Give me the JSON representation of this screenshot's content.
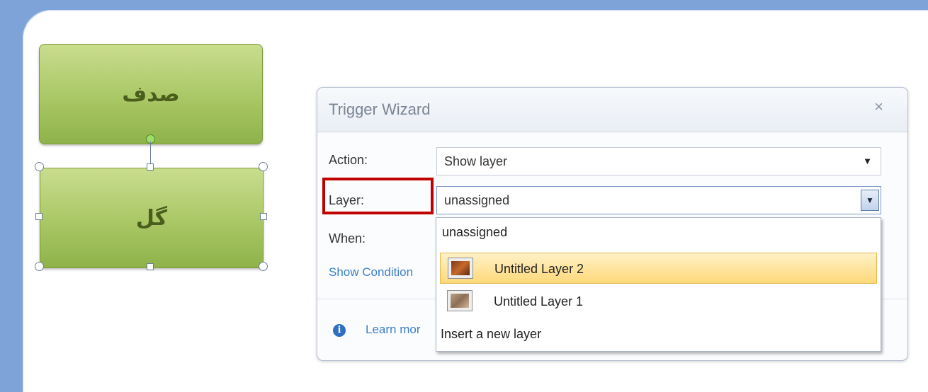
{
  "slide": {
    "shape_top_text": "صدف",
    "shape_bottom_text": "گل"
  },
  "dialog": {
    "title": "Trigger Wizard",
    "close_glyph": "×",
    "action_label": "Action:",
    "action_value": "Show layer",
    "layer_label": "Layer:",
    "layer_value": "unassigned",
    "when_label": "When:",
    "show_conditions_link": "Show Condition",
    "learn_more_link": "Learn mor",
    "dropdown_arrow_glyph": "▼",
    "info_glyph": "i"
  },
  "layer_dropdown": {
    "items": [
      {
        "label": "unassigned"
      },
      {
        "label": "Untitled Layer 2",
        "selected": true
      },
      {
        "label": "Untitled Layer 1"
      },
      {
        "label": "Insert a new layer"
      }
    ]
  },
  "colors": {
    "highlight_outline": "#c00000",
    "shape_fill": "#a9c765",
    "selected_item": "#ffd97a"
  }
}
